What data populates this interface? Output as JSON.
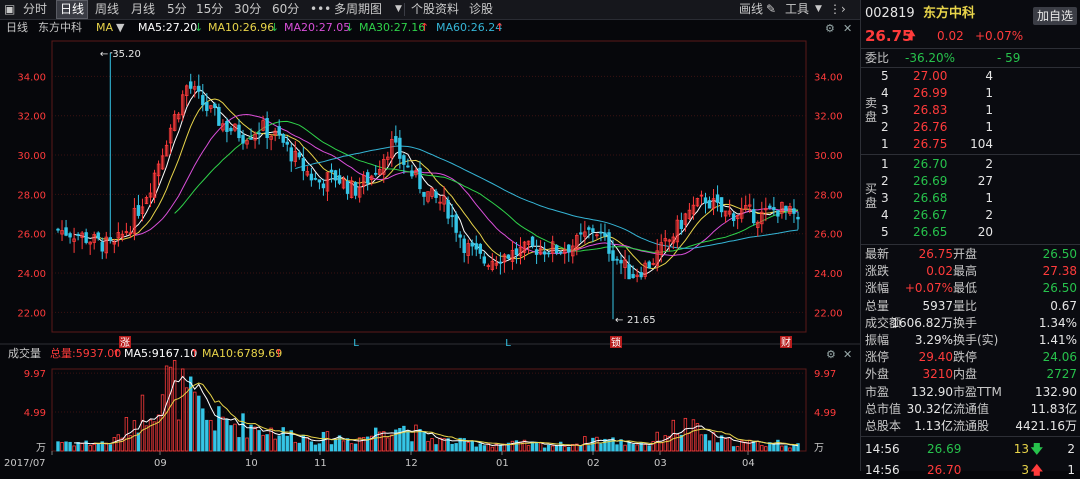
{
  "toolbar": {
    "items": [
      "分时",
      "日线",
      "周线",
      "月线",
      "5分",
      "15分",
      "30分",
      "60分",
      "•••",
      "多周期图",
      "个股资料",
      "诊股"
    ],
    "active_index": 1,
    "draw_label": "画线",
    "tools_label": "工具"
  },
  "main": {
    "period": "日线",
    "name": "东方中科",
    "indicator": "MA",
    "ma5": "MA5:27.20",
    "ma10": "MA10:26.96",
    "ma20": "MA20:27.05",
    "ma30": "MA30:27.16",
    "ma60": "MA60:26.24",
    "high_label": "35.20",
    "low_label": "21.65",
    "markers": [
      "涨",
      "L",
      "L",
      "锁",
      "财"
    ]
  },
  "volume_panel": {
    "title": "成交量",
    "total": "总量:5937.00",
    "ma5": "MA5:9167.10",
    "ma10": "MA10:6789.69",
    "unit": "万"
  },
  "colors": {
    "up": "#ff3b3b",
    "down": "#35c5e6",
    "ma5": "#ffffff",
    "ma10": "#e8d44a",
    "ma20": "#d94fd9",
    "ma30": "#2fd24a",
    "ma60": "#35b5d6",
    "bg": "#06070b"
  },
  "chart_data": {
    "type": "candlestick",
    "x_ticks": [
      "2017/07",
      "09",
      "10",
      "11",
      "12",
      "01",
      "02",
      "03",
      "04"
    ],
    "price_ylim": [
      21.0,
      35.8
    ],
    "price_ticks": [
      "34.00",
      "32.00",
      "30.00",
      "28.00",
      "26.00",
      "24.00",
      "22.00"
    ],
    "volume_ylim": [
      0,
      10.5
    ],
    "volume_ticks": [
      "9.97",
      "4.99",
      "万"
    ],
    "anchors": {
      "close": [
        26.2,
        26.0,
        25.6,
        25.3,
        26.6,
        28.5,
        31.2,
        33.6,
        32.4,
        31.5,
        31.0,
        31.4,
        30.8,
        29.6,
        28.6,
        28.9,
        28.2,
        29.0,
        30.6,
        29.2,
        28.0,
        27.4,
        25.4,
        24.6,
        24.9,
        25.1,
        25.3,
        25.2,
        25.5,
        26.3,
        25.0,
        23.9,
        24.5,
        25.6,
        27.0,
        27.8,
        27.0,
        27.1,
        26.9,
        27.3,
        26.75
      ],
      "volume": [
        1.2,
        1.0,
        0.9,
        1.1,
        3.5,
        6.0,
        8.5,
        6.5,
        4.0,
        3.5,
        3.2,
        2.8,
        2.2,
        1.8,
        1.5,
        1.6,
        1.4,
        2.0,
        3.5,
        2.5,
        1.5,
        1.2,
        1.0,
        0.9,
        0.8,
        0.9,
        0.8,
        0.7,
        0.9,
        1.5,
        1.2,
        1.0,
        0.9,
        2.5,
        3.0,
        1.8,
        1.2,
        1.0,
        0.9,
        1.0,
        0.6
      ]
    }
  },
  "panel": {
    "code": "002819",
    "name": "东方中科",
    "add_label": "加自选",
    "price": "26.75",
    "change": "0.02",
    "change_pct": "+0.07%",
    "weibi_label": "委比",
    "weibi_pct": "-36.20%",
    "weibi_diff": "- 59",
    "sell_label": "卖盘",
    "buy_label": "买盘",
    "sells": [
      {
        "idx": "5",
        "price": "27.00",
        "vol": "4"
      },
      {
        "idx": "4",
        "price": "26.99",
        "vol": "1"
      },
      {
        "idx": "3",
        "price": "26.83",
        "vol": "1"
      },
      {
        "idx": "2",
        "price": "26.76",
        "vol": "1"
      },
      {
        "idx": "1",
        "price": "26.75",
        "vol": "104"
      }
    ],
    "buys": [
      {
        "idx": "1",
        "price": "26.70",
        "vol": "2"
      },
      {
        "idx": "2",
        "price": "26.69",
        "vol": "27"
      },
      {
        "idx": "3",
        "price": "26.68",
        "vol": "1"
      },
      {
        "idx": "4",
        "price": "26.67",
        "vol": "2"
      },
      {
        "idx": "5",
        "price": "26.65",
        "vol": "20"
      }
    ],
    "stats": [
      {
        "l1": "最新",
        "v1": "26.75",
        "c1": "red",
        "l2": "开盘",
        "v2": "26.50",
        "c2": "green"
      },
      {
        "l1": "涨跌",
        "v1": "0.02",
        "c1": "red",
        "l2": "最高",
        "v2": "27.38",
        "c2": "red"
      },
      {
        "l1": "涨幅",
        "v1": "+0.07%",
        "c1": "red",
        "l2": "最低",
        "v2": "26.50",
        "c2": "green"
      },
      {
        "l1": "总量",
        "v1": "5937",
        "c1": "white",
        "l2": "量比",
        "v2": "0.67",
        "c2": "white"
      },
      {
        "l1": "成交额",
        "v1": "1606.82万",
        "c1": "white",
        "l2": "换手",
        "v2": "1.34%",
        "c2": "white"
      },
      {
        "l1": "振幅",
        "v1": "3.29%",
        "c1": "white",
        "l2": "换手(实)",
        "v2": "1.41%",
        "c2": "white"
      },
      {
        "l1": "涨停",
        "v1": "29.40",
        "c1": "red",
        "l2": "跌停",
        "v2": "24.06",
        "c2": "green"
      },
      {
        "l1": "外盘",
        "v1": "3210",
        "c1": "red",
        "l2": "内盘",
        "v2": "2727",
        "c2": "green"
      },
      {
        "l1": "市盈",
        "v1": "132.90",
        "c1": "white",
        "l2": "市盈TTM",
        "v2": "132.90",
        "c2": "white"
      },
      {
        "l1": "总市值",
        "v1": "30.32亿",
        "c1": "white",
        "l2": "流通值",
        "v2": "11.83亿",
        "c2": "white"
      },
      {
        "l1": "总股本",
        "v1": "1.13亿",
        "c1": "white",
        "l2": "流通股",
        "v2": "4421.16万",
        "c2": "white"
      }
    ],
    "tick": {
      "time": "14:56",
      "price": "26.69",
      "vol": "13",
      "num": "2"
    },
    "tick2": {
      "time": "14:56",
      "price": "26.70",
      "vol": "3",
      "num": "1"
    }
  }
}
